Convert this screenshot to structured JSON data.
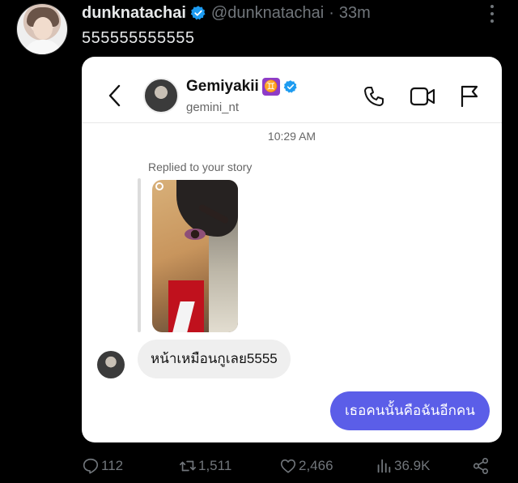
{
  "tweet": {
    "display_name": "dunknatachai",
    "handle": "@dunknatachai",
    "separator": "·",
    "time": "33m",
    "text": "555555555555"
  },
  "dm": {
    "contact_name": "Gemiyakii",
    "contact_emoji": "♊",
    "contact_username": "gemini_nt",
    "timestamp": "10:29 AM",
    "replied_label": "Replied to your story",
    "incoming_message": "หน้าเหมือนกูเลย5555",
    "outgoing_message": "เธอคนนั้นคือฉันอีกคน"
  },
  "actions": {
    "replies": "112",
    "retweets": "1,511",
    "likes": "2,466",
    "views": "36.9K"
  },
  "colors": {
    "background": "#000000",
    "verified_blue": "#1d9bf0",
    "outgoing_bubble": "#5b5ee8",
    "muted_text": "#71767b"
  },
  "icons": [
    "verified-icon",
    "more-icon",
    "back-icon",
    "phone-icon",
    "video-icon",
    "flag-icon",
    "reply-icon",
    "retweet-icon",
    "like-icon",
    "views-icon",
    "share-icon"
  ]
}
